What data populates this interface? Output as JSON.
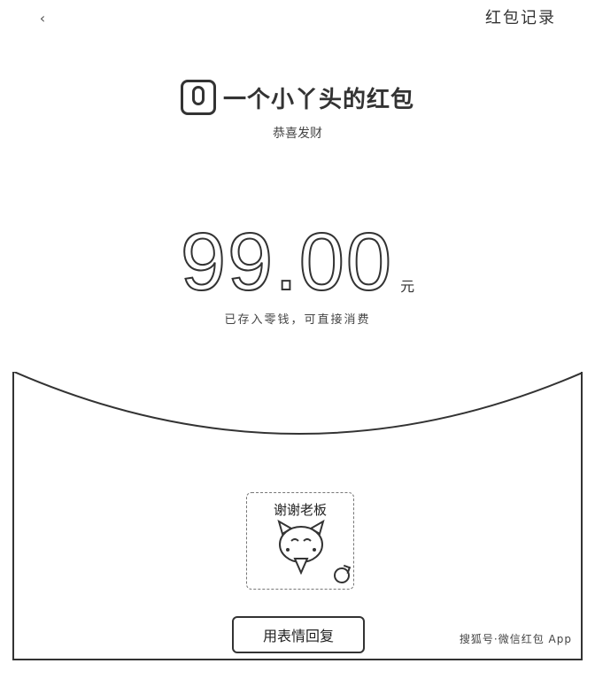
{
  "topbar": {
    "back_glyph": "‹",
    "records_label": "红包记录"
  },
  "header": {
    "title": "一个小丫头的红包",
    "greeting": "恭喜发财"
  },
  "amount": {
    "value": "99.00",
    "unit": "元",
    "note": "已存入零钱，可直接消费"
  },
  "sticker": {
    "text": "谢谢老板"
  },
  "reply": {
    "label": "用表情回复"
  },
  "watermark": {
    "text": "搜狐号·微信红包 App"
  },
  "icons": {
    "back": "chevron-left-icon",
    "avatar": "user-avatar",
    "sticker_face": "cat-sticker-icon",
    "refresh": "refresh-icon"
  }
}
